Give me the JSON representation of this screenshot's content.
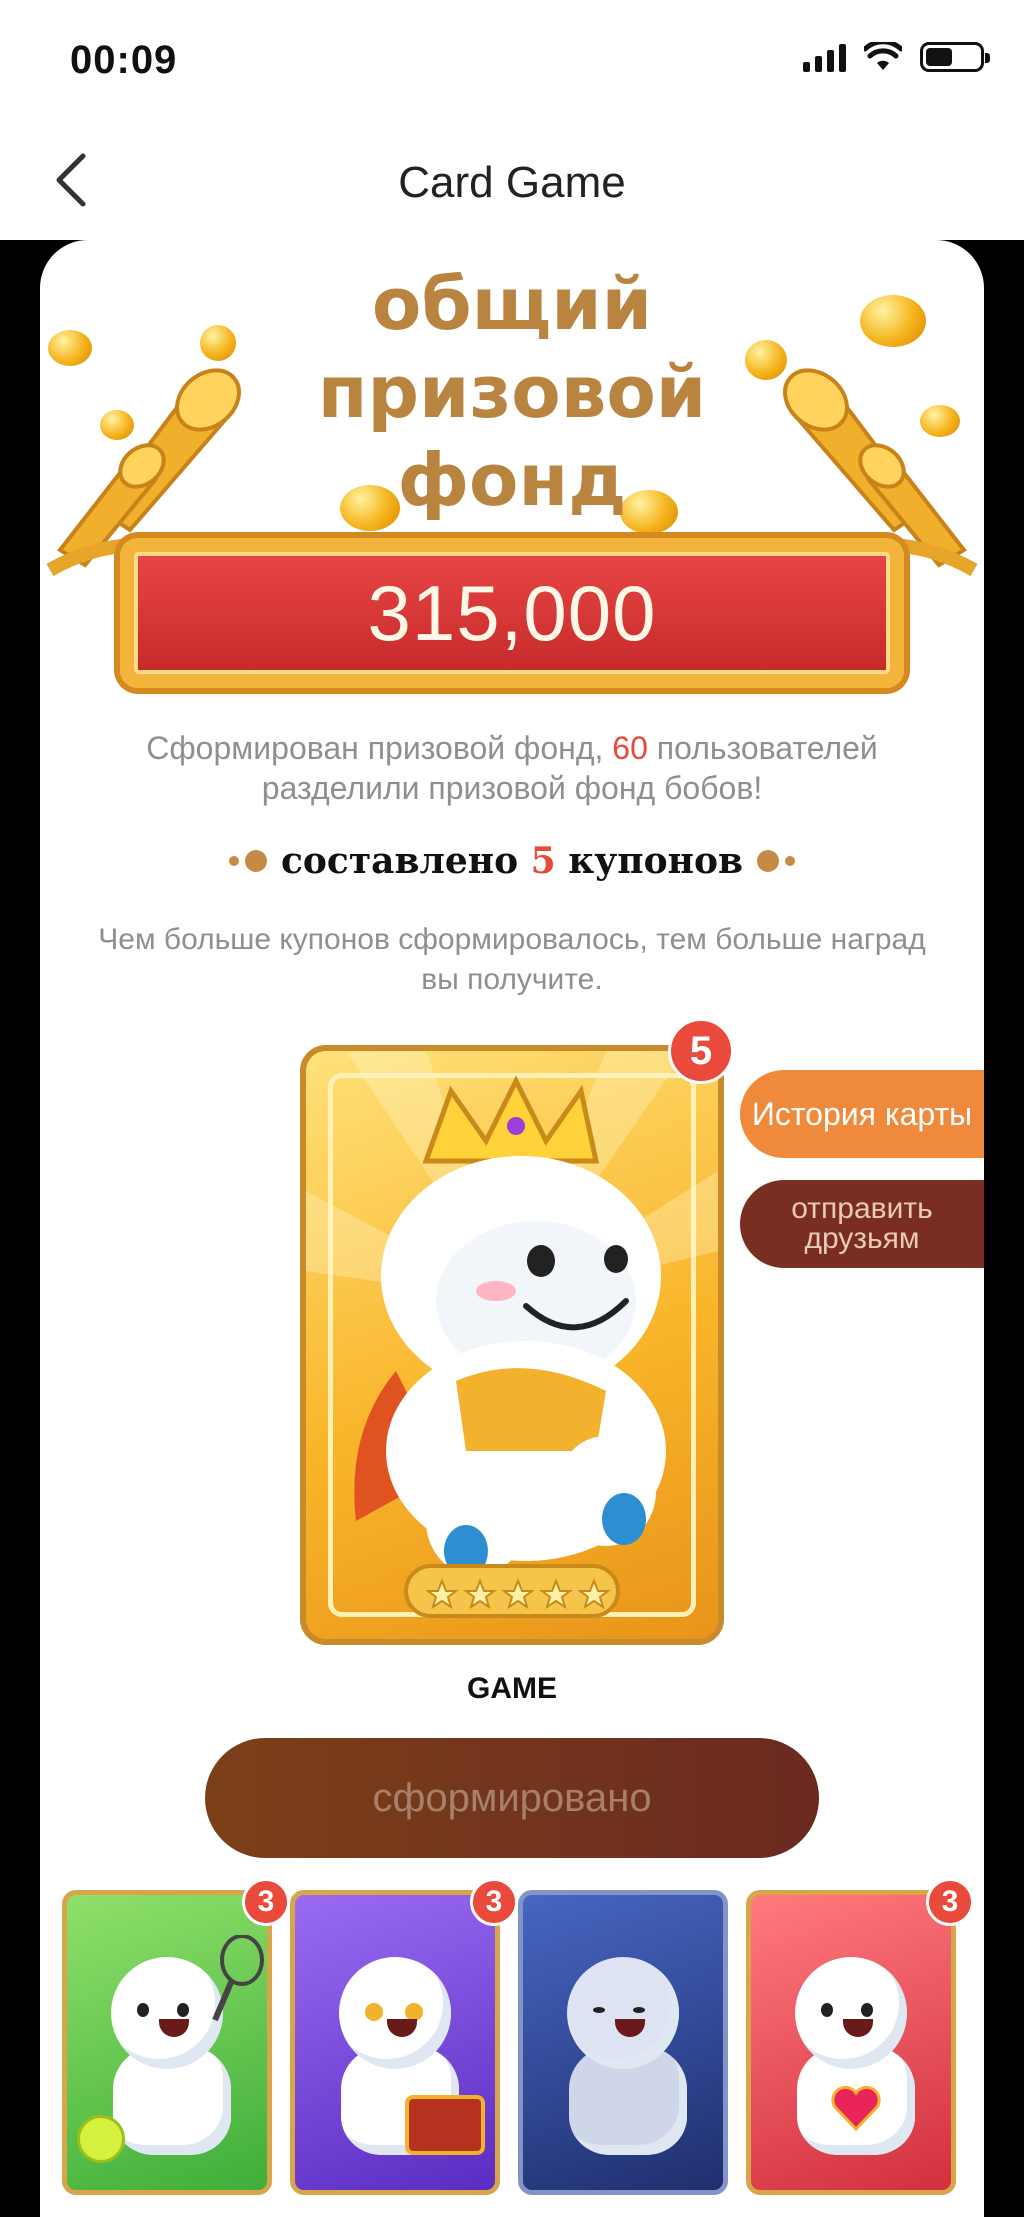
{
  "status_bar": {
    "time": "00:09"
  },
  "nav": {
    "title": "Card Game",
    "back_icon": "chevron-left-icon"
  },
  "banner": {
    "title": "общий призовой фонд",
    "amount": "315,000"
  },
  "description": {
    "part1": "Сформирован призовой фонд, ",
    "user_count": "60",
    "part2": " пользователей разделили призовой фонд бобов!"
  },
  "coupons": {
    "prefix": "составлено ",
    "count": "5",
    "suffix": " купонов"
  },
  "hint": "Чем больше купонов сформировалось, тем больше наград вы получите.",
  "main_card": {
    "name": "GAME",
    "badge": "5",
    "stars": 5
  },
  "side_buttons": {
    "history": "История карты",
    "send": "отправить друзьям"
  },
  "formed_button": "сформировано",
  "mini_cards": [
    {
      "theme": "tennis",
      "badge": "3",
      "bg": "#5ec44a"
    },
    {
      "theme": "treasure",
      "badge": "3",
      "bg": "#6b3fd6"
    },
    {
      "theme": "gamer",
      "badge": "",
      "bg": "#2b4aa0"
    },
    {
      "theme": "cupid",
      "badge": "3",
      "bg": "#e2454b"
    }
  ],
  "colors": {
    "accent": "#b8843f",
    "badge_red": "#ea4a3b",
    "history_orange": "#ef8a3c",
    "send_brown": "#7a2e22"
  }
}
